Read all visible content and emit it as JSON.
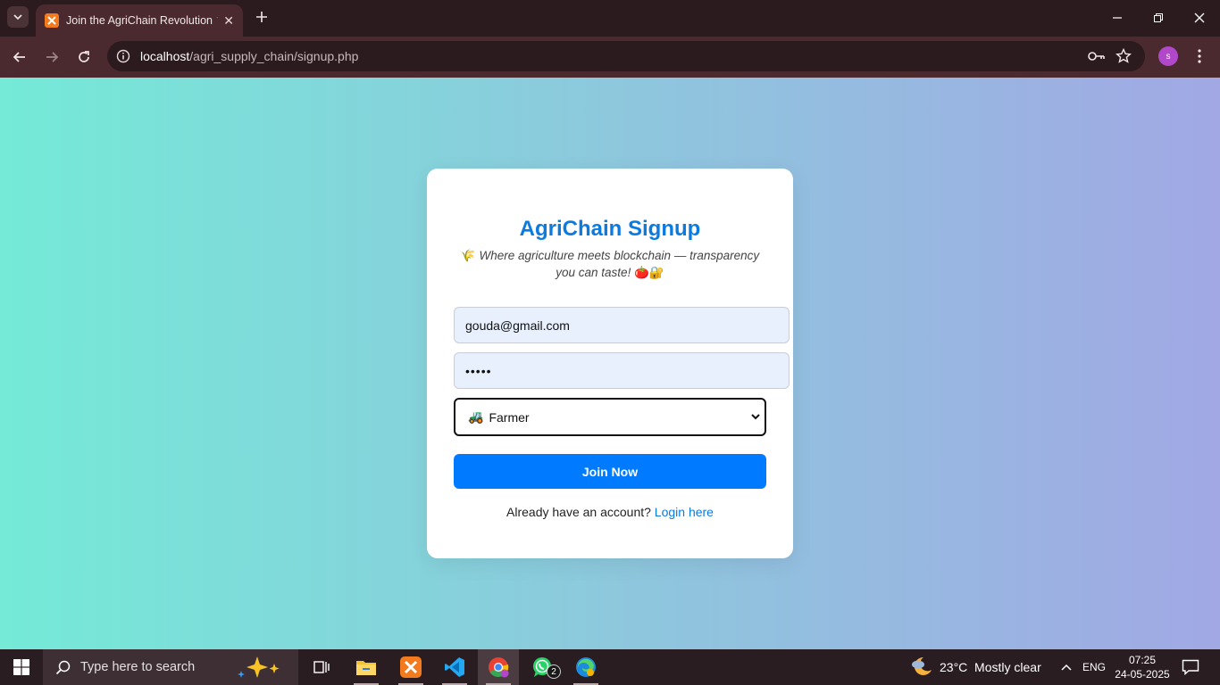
{
  "browser": {
    "tab_title": "Join the AgriChain Revolution 🌾",
    "url_host": "localhost",
    "url_path": "/agri_supply_chain/signup.php",
    "profile_initial": "s"
  },
  "page": {
    "heading": "AgriChain Signup",
    "tagline_icon": "🌾",
    "tagline": "Where agriculture meets blockchain — transparency you can taste!",
    "tagline_emoji": "🍅🔐",
    "email_value": "gouda@gmail.com",
    "password_mask": "•••••",
    "role_icon": "🚜",
    "role_selected": "Farmer",
    "join_label": "Join Now",
    "login_prompt": "Already have an account?",
    "login_link": "Login here",
    "accent_color": "#007bff"
  },
  "taskbar": {
    "search_placeholder": "Type here to search",
    "whatsapp_badge": "2",
    "weather": "23°C  Mostly clear",
    "language": "ENG",
    "time": "07:25",
    "date": "24-05-2025"
  }
}
